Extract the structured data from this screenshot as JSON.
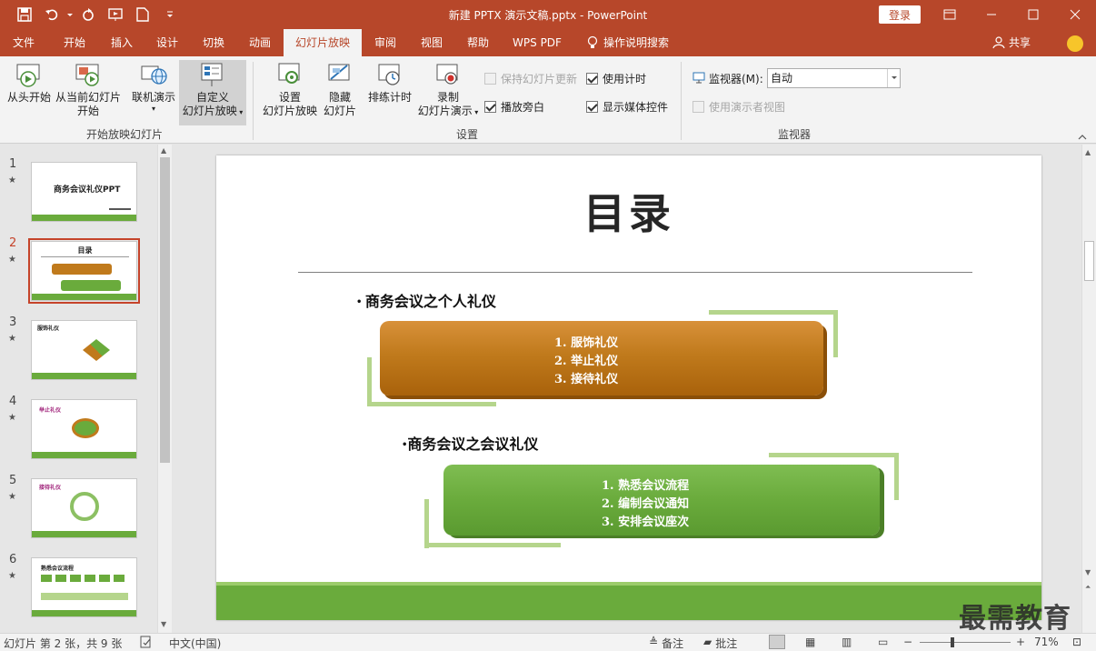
{
  "app": {
    "title": "新建 PPTX 演示文稿.pptx  -  PowerPoint",
    "login_label": "登录",
    "share_label": "共享"
  },
  "tabs": [
    "文件",
    "开始",
    "插入",
    "设计",
    "切换",
    "动画",
    "幻灯片放映",
    "审阅",
    "视图",
    "帮助",
    "WPS PDF",
    "操作说明搜索"
  ],
  "active_tab": "幻灯片放映",
  "ribbon": {
    "start_group": {
      "label": "开始放映幻灯片",
      "from_beginning": "从头开始",
      "from_current_1": "从当前幻灯片",
      "from_current_2": "开始",
      "online": "联机演示",
      "custom_1": "自定义",
      "custom_2": "幻灯片放映"
    },
    "setup_group": {
      "label": "设置",
      "setup_1": "设置",
      "setup_2": "幻灯片放映",
      "hide_1": "隐藏",
      "hide_2": "幻灯片",
      "rehearse": "排练计时",
      "record_1": "录制",
      "record_2": "幻灯片演示",
      "keep_updated": "保持幻灯片更新",
      "play_narration": "播放旁白",
      "use_timings": "使用计时",
      "show_media": "显示媒体控件"
    },
    "monitor_group": {
      "label": "监视器",
      "monitor_label": "监视器(M):",
      "monitor_value": "自动",
      "presenter_view": "使用演示者视图"
    }
  },
  "slides": [
    {
      "num": "1",
      "title": "商务会议礼仪PPT"
    },
    {
      "num": "2",
      "title": "目录"
    },
    {
      "num": "3",
      "title": "服饰礼仪"
    },
    {
      "num": "4",
      "title": "举止礼仪"
    },
    {
      "num": "5",
      "title": "接待礼仪"
    },
    {
      "num": "6",
      "title": "熟悉会议流程"
    }
  ],
  "current_slide": {
    "title": "目录",
    "section1": {
      "heading": "商务会议之个人礼仪",
      "items": [
        "1.  服饰礼仪",
        "2.  举止礼仪",
        "3.  接待礼仪"
      ]
    },
    "section2": {
      "heading": "商务会议之会议礼仪",
      "items": [
        "1.  熟悉会议流程",
        "2.  编制会议通知",
        "3.  安排会议座次"
      ]
    }
  },
  "status": {
    "slide_info": "幻灯片 第 2 张，共 9 张",
    "language": "中文(中国)",
    "notes": "备注",
    "comments": "批注",
    "zoom": "71%"
  },
  "watermark": "最需教育",
  "colors": {
    "accent": "#b7472a",
    "green": "#6aab3c",
    "orange": "#c07a1c"
  }
}
